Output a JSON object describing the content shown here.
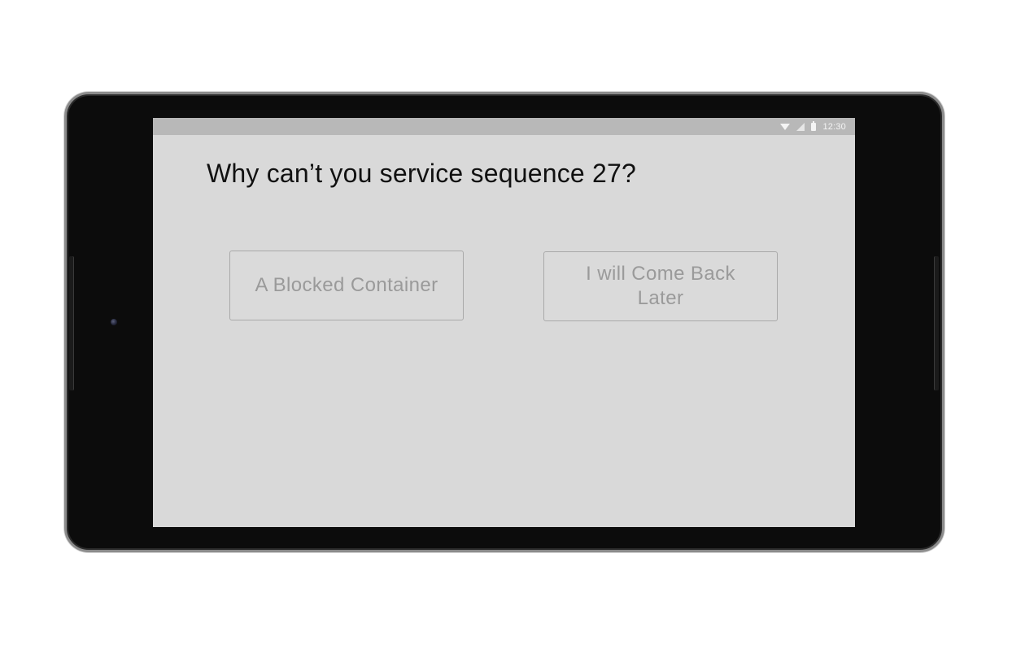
{
  "status_bar": {
    "time": "12:30",
    "icons": [
      "wifi-icon",
      "signal-icon",
      "battery-icon"
    ]
  },
  "question": {
    "text": "Why can’t you service sequence 27?"
  },
  "choices": [
    {
      "label": "A Blocked Container"
    },
    {
      "label": "I will Come Back Later"
    }
  ],
  "colors": {
    "device_frame": "#0c0c0c",
    "screen_background": "#d9d9d9",
    "status_bar": "#b8b8b8",
    "question_text": "#111111",
    "button_text": "#9a9a9a",
    "button_border": "#a9a9a9"
  }
}
